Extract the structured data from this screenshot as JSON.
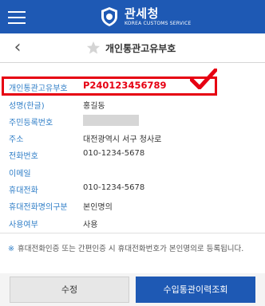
{
  "header": {
    "brand_ko": "관세청",
    "brand_en": "KOREA CUSTOMS SERVICE"
  },
  "page": {
    "title": "개인통관고유부호"
  },
  "info": {
    "rows": [
      {
        "label": "개인통관고유부호",
        "value": "P240123456789"
      },
      {
        "label": "성명(한글)",
        "value": "홍길동"
      },
      {
        "label": "주민등록번호",
        "value": ""
      },
      {
        "label": "주소",
        "value": "대전광역시 서구 청사로"
      },
      {
        "label": "전화번호",
        "value": "010-1234-5678"
      },
      {
        "label": "이메일",
        "value": ""
      },
      {
        "label": "휴대전화",
        "value": "010-1234-5678"
      },
      {
        "label": "휴대전화명의구분",
        "value": "본인명의"
      },
      {
        "label": "사용여부",
        "value": "사용"
      }
    ]
  },
  "notice": {
    "mark": "※",
    "text": "휴대전화인증 또는 간편인증 시 휴대전화번호가 본인명의로 등록됩니다."
  },
  "buttons": {
    "edit": "수정",
    "history": "수입통관이력조회"
  },
  "colors": {
    "primary": "#1e59b4",
    "label": "#2f7ec7",
    "highlight": "#e60012"
  },
  "icons": {
    "menu": "hamburger-icon",
    "back": "chevron-left-icon",
    "favorite": "star-icon",
    "logo": "customs-emblem-icon",
    "annotation": "checkmark-icon"
  }
}
